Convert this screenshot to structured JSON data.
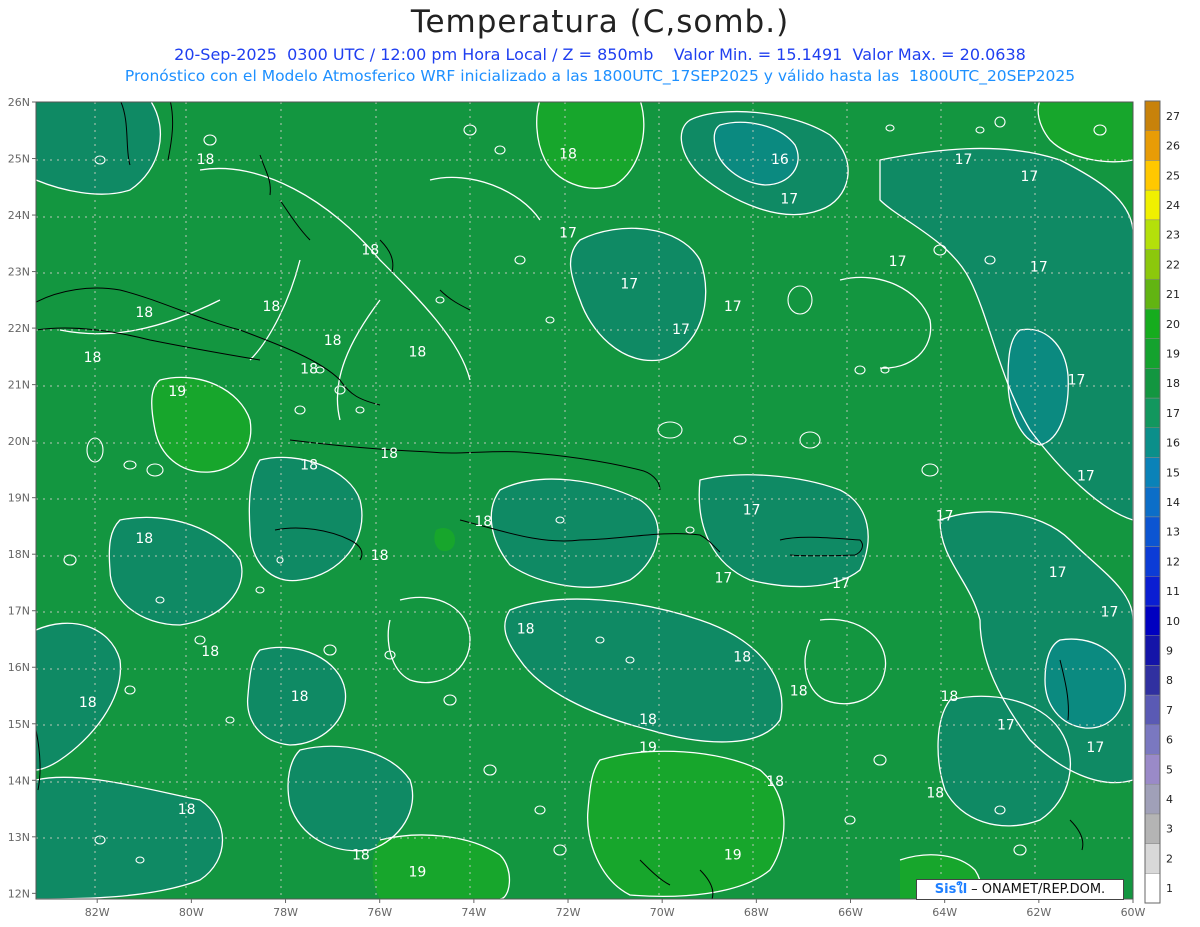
{
  "header": {
    "title": "Temperatura (C,somb.)",
    "line1": "20-Sep-2025  0300 UTC / 12:00 pm Hora Local / Z = 850mb    Valor Min. = 15.1491  Valor Max. = 20.0638",
    "line2": "Pronóstico con el Modelo Atmosferico WRF inicializado a las 1800UTC_17SEP2025 y válido hasta las  1800UTC_20SEP2025"
  },
  "map": {
    "lat_labels": [
      "26N",
      "25N",
      "24N",
      "23N",
      "22N",
      "21N",
      "20N",
      "19N",
      "18N",
      "17N",
      "16N",
      "15N",
      "14N",
      "13N",
      "12N"
    ],
    "lon_labels": [
      "82W",
      "80W",
      "78W",
      "76W",
      "74W",
      "72W",
      "70W",
      "68W",
      "66W",
      "64W",
      "62W",
      "60W"
    ],
    "contour_labels": [
      {
        "text": "18",
        "lon": -79.7,
        "lat": 24.9
      },
      {
        "text": "18",
        "lon": -78.3,
        "lat": 22.3
      },
      {
        "text": "18",
        "lon": -76.2,
        "lat": 23.3
      },
      {
        "text": "18",
        "lon": -81.0,
        "lat": 22.2
      },
      {
        "text": "18",
        "lon": -82.1,
        "lat": 21.4
      },
      {
        "text": "18",
        "lon": -77.0,
        "lat": 21.7
      },
      {
        "text": "18",
        "lon": -75.2,
        "lat": 21.5
      },
      {
        "text": "18",
        "lon": -77.5,
        "lat": 21.2
      },
      {
        "text": "19",
        "lon": -80.3,
        "lat": 20.8
      },
      {
        "text": "18",
        "lon": -77.5,
        "lat": 19.5
      },
      {
        "text": "18",
        "lon": -75.8,
        "lat": 19.7
      },
      {
        "text": "18",
        "lon": -73.8,
        "lat": 18.5
      },
      {
        "text": "18",
        "lon": -81.0,
        "lat": 18.2
      },
      {
        "text": "18",
        "lon": -76.0,
        "lat": 17.9
      },
      {
        "text": "18",
        "lon": -79.6,
        "lat": 16.2
      },
      {
        "text": "18",
        "lon": -82.2,
        "lat": 15.3
      },
      {
        "text": "18",
        "lon": -77.7,
        "lat": 15.4
      },
      {
        "text": "18",
        "lon": -72.9,
        "lat": 16.6
      },
      {
        "text": "18",
        "lon": -72.0,
        "lat": 25.0
      },
      {
        "text": "17",
        "lon": -72.0,
        "lat": 23.6
      },
      {
        "text": "17",
        "lon": -70.7,
        "lat": 22.7
      },
      {
        "text": "17",
        "lon": -69.6,
        "lat": 21.9
      },
      {
        "text": "17",
        "lon": -68.5,
        "lat": 22.3
      },
      {
        "text": "16",
        "lon": -67.5,
        "lat": 24.9
      },
      {
        "text": "17",
        "lon": -67.3,
        "lat": 24.2
      },
      {
        "text": "17",
        "lon": -65.0,
        "lat": 23.1
      },
      {
        "text": "17",
        "lon": -63.6,
        "lat": 24.9
      },
      {
        "text": "17",
        "lon": -62.2,
        "lat": 24.6
      },
      {
        "text": "17",
        "lon": -62.0,
        "lat": 23.0
      },
      {
        "text": "17",
        "lon": -61.2,
        "lat": 21.0
      },
      {
        "text": "17",
        "lon": -61.0,
        "lat": 19.3
      },
      {
        "text": "17",
        "lon": -64.0,
        "lat": 18.6
      },
      {
        "text": "17",
        "lon": -68.1,
        "lat": 18.7
      },
      {
        "text": "17",
        "lon": -68.7,
        "lat": 17.5
      },
      {
        "text": "17",
        "lon": -66.2,
        "lat": 17.4
      },
      {
        "text": "17",
        "lon": -61.6,
        "lat": 17.6
      },
      {
        "text": "17",
        "lon": -60.5,
        "lat": 16.9
      },
      {
        "text": "18",
        "lon": -68.3,
        "lat": 16.1
      },
      {
        "text": "18",
        "lon": -67.1,
        "lat": 15.5
      },
      {
        "text": "18",
        "lon": -63.9,
        "lat": 15.4
      },
      {
        "text": "17",
        "lon": -62.7,
        "lat": 14.9
      },
      {
        "text": "17",
        "lon": -60.8,
        "lat": 14.5
      },
      {
        "text": "18",
        "lon": -70.3,
        "lat": 15.0
      },
      {
        "text": "19",
        "lon": -70.3,
        "lat": 14.5
      },
      {
        "text": "18",
        "lon": -67.6,
        "lat": 13.9
      },
      {
        "text": "18",
        "lon": -64.2,
        "lat": 13.7
      },
      {
        "text": "19",
        "lon": -68.5,
        "lat": 12.6
      },
      {
        "text": "19",
        "lon": -75.2,
        "lat": 12.3
      },
      {
        "text": "18",
        "lon": -80.1,
        "lat": 13.4
      },
      {
        "text": "18",
        "lon": -76.4,
        "lat": 12.6
      }
    ]
  },
  "colorbar": {
    "labels": [
      "1",
      "2",
      "3",
      "4",
      "5",
      "6",
      "7",
      "8",
      "9",
      "10",
      "11",
      "12",
      "13",
      "14",
      "15",
      "16",
      "17",
      "18",
      "19",
      "20",
      "21",
      "22",
      "23",
      "24",
      "25",
      "26",
      "27"
    ],
    "colors": [
      "#ffffff",
      "#d8d8d8",
      "#b4b4b4",
      "#a0a0b8",
      "#9a8ac8",
      "#7a78c0",
      "#5a5ab4",
      "#3030a0",
      "#1414a8",
      "#0000c0",
      "#0a1ed2",
      "#0c3cd6",
      "#0c55d2",
      "#0c6ec8",
      "#0a82b8",
      "#0b8f8a",
      "#12975e",
      "#139640",
      "#14a22e",
      "#16ac1e",
      "#62b412",
      "#8cc80c",
      "#b4e00a",
      "#f0f000",
      "#ffc800",
      "#e89c06",
      "#c8820a"
    ]
  },
  "credit": {
    "brand": "Sisใl",
    "text": "– ONAMET/REP.DOM."
  }
}
